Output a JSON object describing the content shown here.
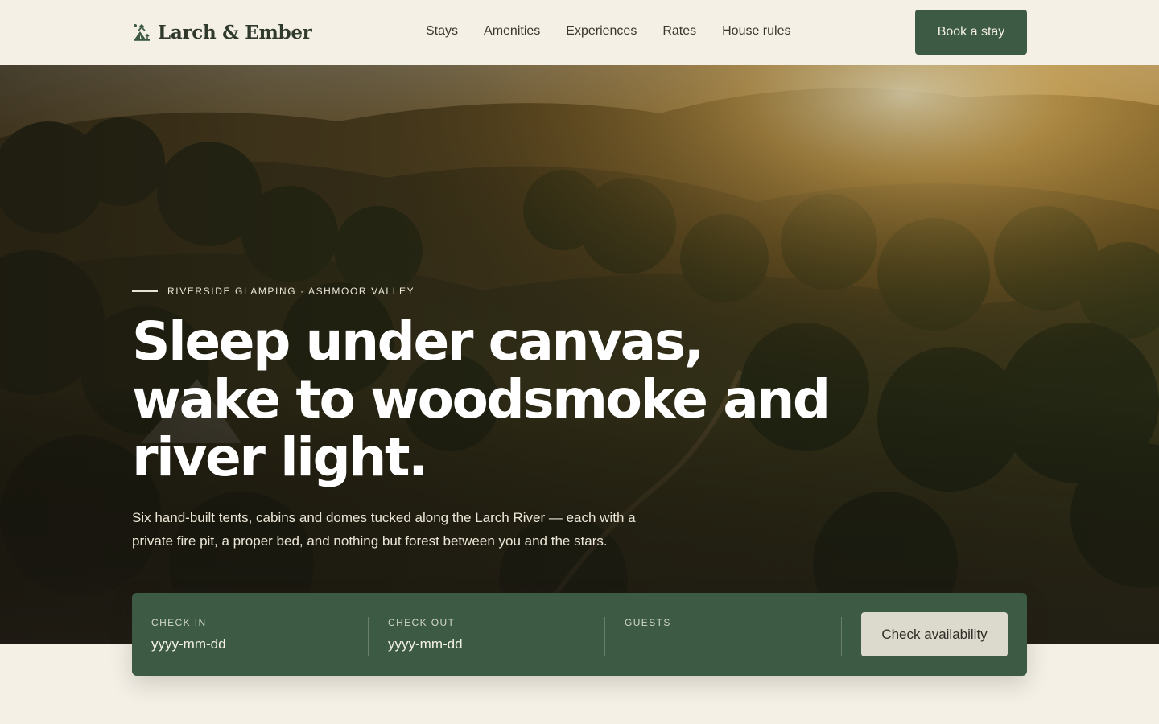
{
  "brand": {
    "name": "Larch & Ember",
    "icon": "camp-icon"
  },
  "nav": {
    "items": [
      "Stays",
      "Amenities",
      "Experiences",
      "Rates",
      "House rules"
    ]
  },
  "header": {
    "cta_label": "Book a stay"
  },
  "hero": {
    "eyebrow": "RIVERSIDE GLAMPING · ASHMOOR VALLEY",
    "headline_lines": [
      "Sleep under canvas,",
      "wake to woodsmoke and",
      "river light."
    ],
    "subcopy": "Six hand-built tents, cabins and domes tucked along the Larch River — each with a private fire pit, a proper bed, and nothing but forest between you and the stars."
  },
  "booking": {
    "check_in": {
      "label": "CHECK IN",
      "placeholder": "yyyy-mm-dd"
    },
    "check_out": {
      "label": "CHECK OUT",
      "placeholder": "yyyy-mm-dd"
    },
    "guests": {
      "label": "GUESTS",
      "value": ""
    },
    "submit_label": "Check availability"
  },
  "colors": {
    "forest": "#3d5a44",
    "cream": "#f4f0e6",
    "sand_button": "#dcdacd"
  }
}
